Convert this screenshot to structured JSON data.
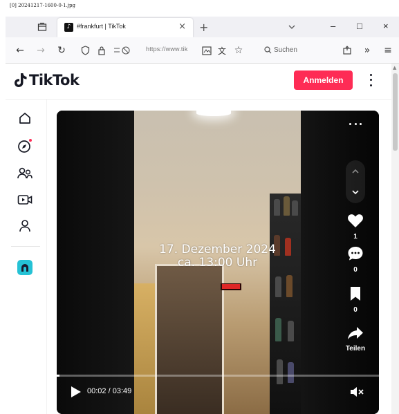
{
  "image_caption": "[0] 20241217-1600-0-1.jpg",
  "browser": {
    "tab_title": "#frankfurt | TikTok",
    "tab_close": "×",
    "new_tab": "+",
    "url": "https://www.tik",
    "search_placeholder": "Suchen",
    "minimize": "–",
    "maximize": "□",
    "close": "×",
    "overflow": "»",
    "menu": "≡"
  },
  "header": {
    "logo_text": "TikTok",
    "login_label": "Anmelden"
  },
  "sidebar": {
    "items": [
      "home-icon",
      "explore-icon",
      "following-icon",
      "live-icon",
      "profile-icon"
    ],
    "explore_badge_color": "#fe2c55"
  },
  "video": {
    "overlay_line1": "17. Dezember 2024",
    "overlay_line2": "ca. 13:00 Uhr",
    "likes": "1",
    "comments": "0",
    "favorites": "0",
    "share_label": "Teilen",
    "current_time": "00:02",
    "duration": "03:49",
    "time_separator": " / ",
    "progress_fraction": 0.009
  },
  "colors": {
    "accent": "#fe2c55",
    "text": "#161823"
  }
}
